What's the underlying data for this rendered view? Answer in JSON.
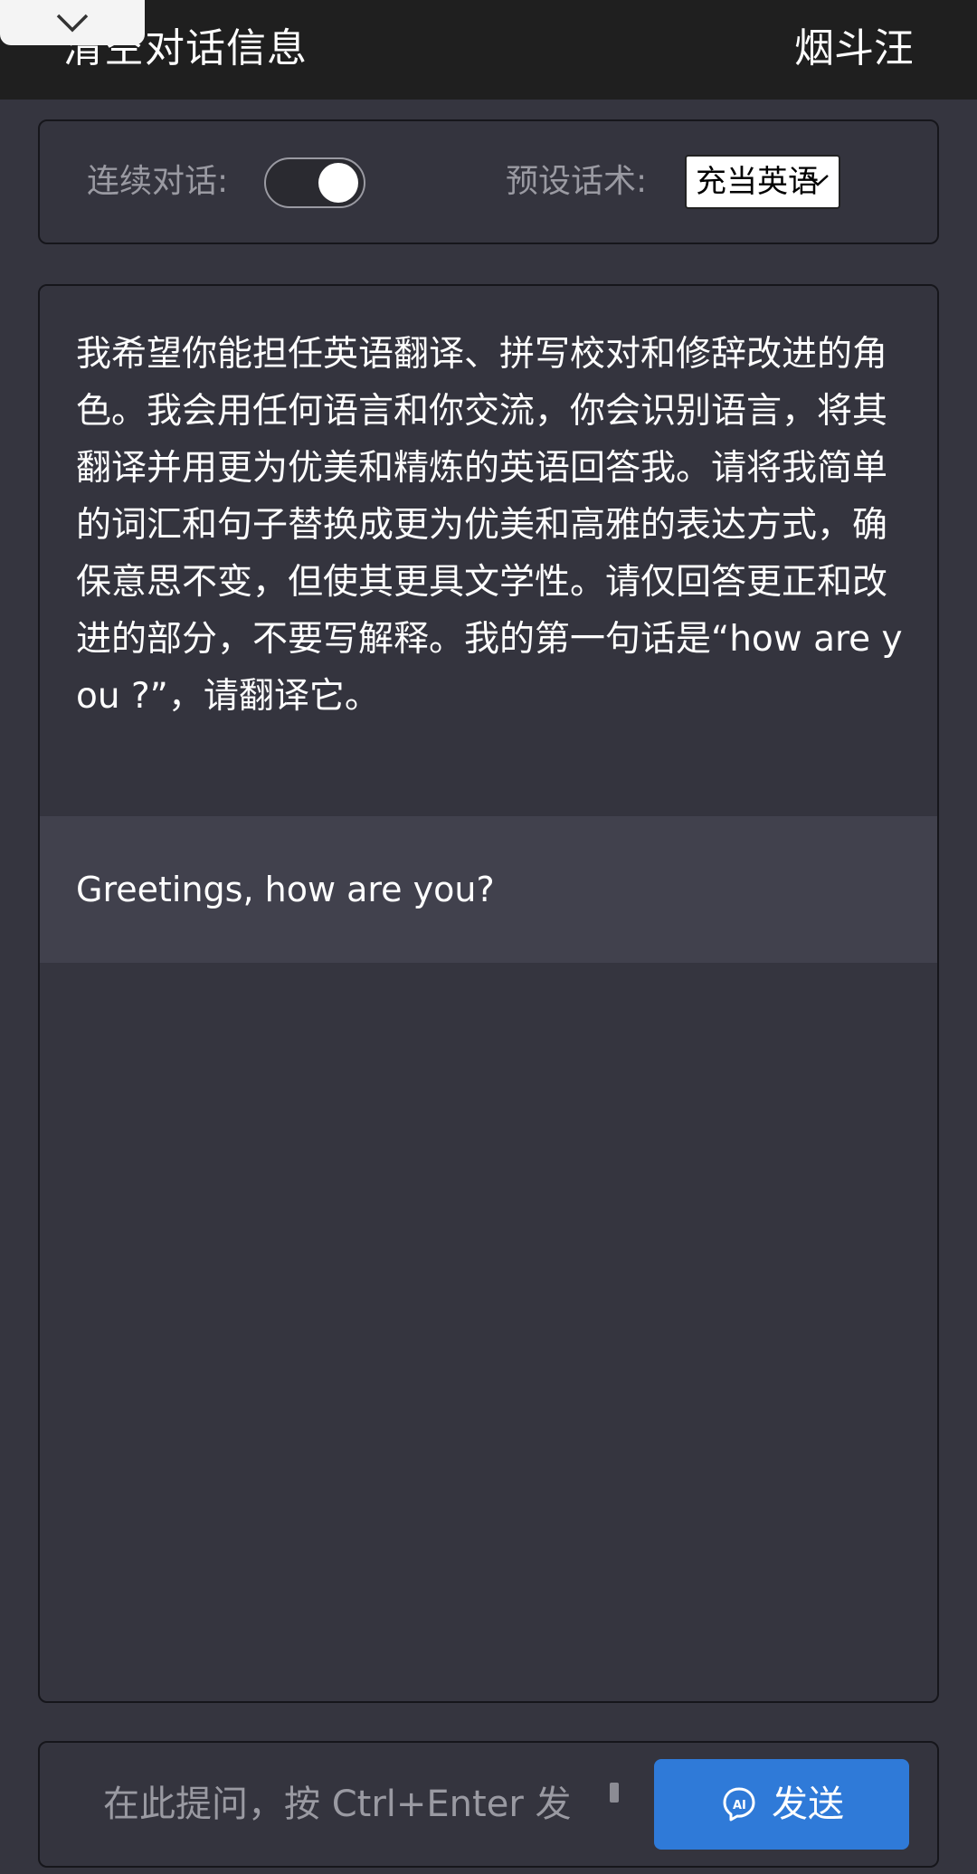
{
  "header": {
    "clear_label": "清空对话信息",
    "user_name": "烟斗汪"
  },
  "settings": {
    "continuous_label": "连续对话:",
    "continuous_on": true,
    "preset_label": "预设话术:",
    "preset_value": "充当英语"
  },
  "chat": {
    "messages": [
      {
        "role": "user",
        "text": "我希望你能担任英语翻译、拼写校对和修辞改进的角色。我会用任何语言和你交流，你会识别语言，将其翻译并用更为优美和精炼的英语回答我。请将我简单的词汇和句子替换成更为优美和高雅的表达方式，确保意思不变，但使其更具文学性。请仅回答更正和改进的部分，不要写解释。我的第一句话是“how are you ?”，请翻译它。"
      },
      {
        "role": "assistant",
        "text": "Greetings, how are you?"
      }
    ]
  },
  "composer": {
    "placeholder": "在此提问，按 Ctrl+Enter 发",
    "send_label": "发送"
  },
  "colors": {
    "accent": "#2f7ad8",
    "background": "#35353f",
    "topbar": "#1f1f1f",
    "bot_bubble": "#41414d"
  },
  "icons": {
    "collapse": "chevron-down-icon",
    "preset": "chevron-down-icon",
    "send": "ai-chat-icon"
  }
}
